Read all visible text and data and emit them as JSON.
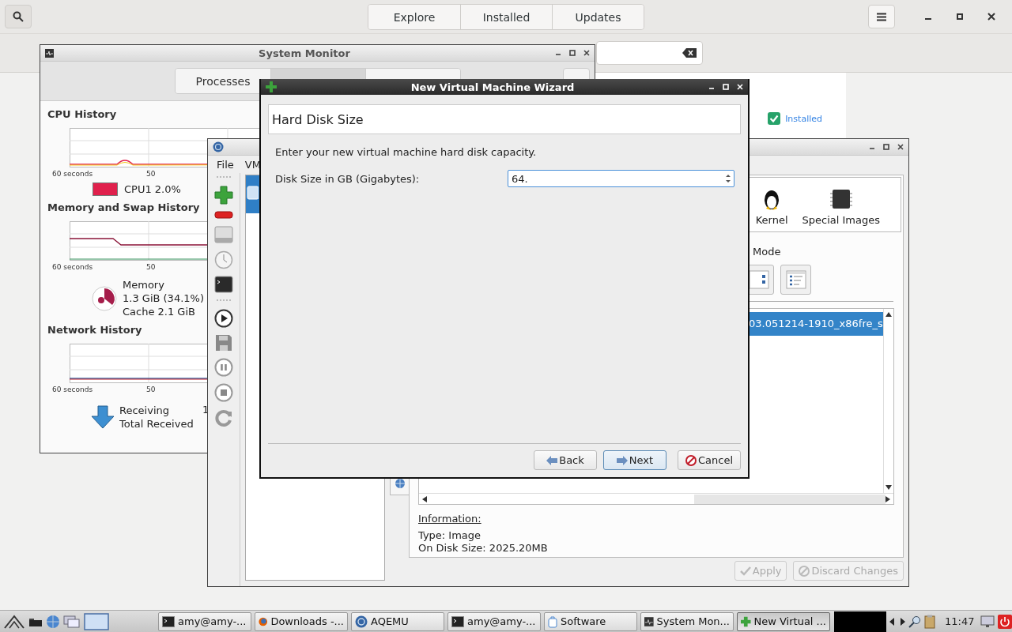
{
  "software": {
    "tabs": [
      {
        "label": "Explore",
        "selected": false
      },
      {
        "label": "Installed",
        "selected": false
      },
      {
        "label": "Updates",
        "selected": false
      }
    ],
    "status": "Installed"
  },
  "system_monitor": {
    "title": "System Monitor",
    "tabs": [
      {
        "label": "Processes",
        "selected": false
      },
      {
        "selected": true
      },
      {
        "selected": false
      }
    ],
    "cpu": {
      "title": "CPU History",
      "x_labels": [
        "60 seconds",
        "50"
      ],
      "legend": "CPU1 2.0%"
    },
    "memory": {
      "title": "Memory and Swap History",
      "x_labels": [
        "60 seconds",
        "50"
      ],
      "label": "Memory",
      "value": "1.3 GiB (34.1%)",
      "cache": "Cache 2.1 GiB"
    },
    "network": {
      "title": "Network History",
      "x_labels": [
        "60 seconds",
        "50"
      ],
      "receiving": "Receiving",
      "receiving_value": "1",
      "total": "Total Received"
    }
  },
  "aqemu": {
    "menu": [
      "File",
      "VM"
    ],
    "categories": [
      "Kernel",
      "Special Images"
    ],
    "view_mode": "Mode",
    "images": [
      {
        "name": "03.051214-1910_x86fre_s",
        "selected": true
      }
    ],
    "info_title": "Information:",
    "info": [
      "Type: Image",
      "On Disk Size: 2025.20MB"
    ],
    "buttons": [
      {
        "label": "Apply",
        "kind": "apply",
        "disabled": true
      },
      {
        "label": "Discard Changes",
        "kind": "discard",
        "disabled": true
      }
    ]
  },
  "wizard": {
    "title": "New Virtual Machine Wizard",
    "page_title": "Hard Disk Size",
    "prompt": "Enter your new virtual machine hard disk capacity.",
    "field_label": "Disk Size in GB (Gigabytes):",
    "value": "64.",
    "buttons": [
      {
        "label": "Back",
        "kind": "back",
        "default": false
      },
      {
        "label": "Next",
        "kind": "next",
        "default": true
      },
      {
        "label": "Cancel",
        "kind": "cancel",
        "default": false
      }
    ]
  },
  "taskbar": {
    "tasks": [
      {
        "label": "amy@amy-...",
        "kind": "terminal",
        "selected": false
      },
      {
        "label": "Downloads -...",
        "kind": "browser",
        "selected": false
      },
      {
        "label": "AQEMU",
        "kind": "aqemu",
        "selected": false
      },
      {
        "label": "amy@amy-...",
        "kind": "terminal",
        "selected": false
      },
      {
        "label": "Software",
        "kind": "software",
        "selected": false
      },
      {
        "label": "System Mon...",
        "kind": "monitor",
        "selected": false
      },
      {
        "label": "New Virtual ...",
        "kind": "wizard",
        "selected": true
      }
    ],
    "clock": "11:47"
  }
}
